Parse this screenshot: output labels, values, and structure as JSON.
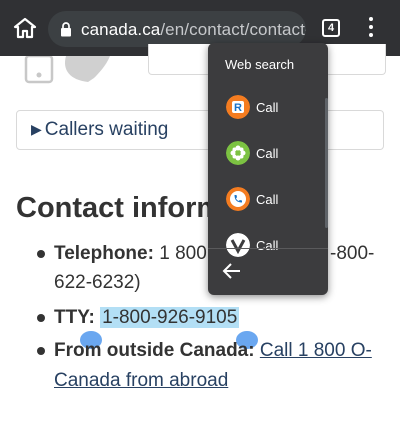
{
  "browser": {
    "url_domain": "canada.ca",
    "url_path": "/en/contact/contact-",
    "tab_count": "4",
    "icons": [
      "home-icon",
      "lock-icon",
      "tabs-icon",
      "more-vert-icon"
    ]
  },
  "page": {
    "callers_waiting": "Callers waiting",
    "heading": "Contact inform",
    "telephone_label": "Telephone:",
    "telephone_value_part1": "1 800",
    "telephone_value_part2": "-800-",
    "telephone_value_line2": "622-6232)",
    "tty_label": "TTY:",
    "tty_value": "1-800-926-9105",
    "outside_label": "From outside Canada:",
    "outside_link_line1": "Call 1 800 O-",
    "outside_link_line2": "Canada from abroad"
  },
  "popup": {
    "title": "Web search",
    "items": [
      {
        "label": "Call",
        "icon": "r-app-icon",
        "color": "#f47c20"
      },
      {
        "label": "Call",
        "icon": "flower-app-icon",
        "color": "#7cc242"
      },
      {
        "label": "Call",
        "icon": "phone-app-icon",
        "color": "#f47c20"
      },
      {
        "label": "Call",
        "icon": "v-app-icon",
        "color": "#ffffff"
      }
    ],
    "back_icon": "back-arrow-icon"
  },
  "colors": {
    "chrome_bg": "#303134",
    "popup_bg": "#3c3c3e",
    "link": "#284162",
    "selection": "#b3dff5",
    "handle": "#6aa7f0"
  }
}
